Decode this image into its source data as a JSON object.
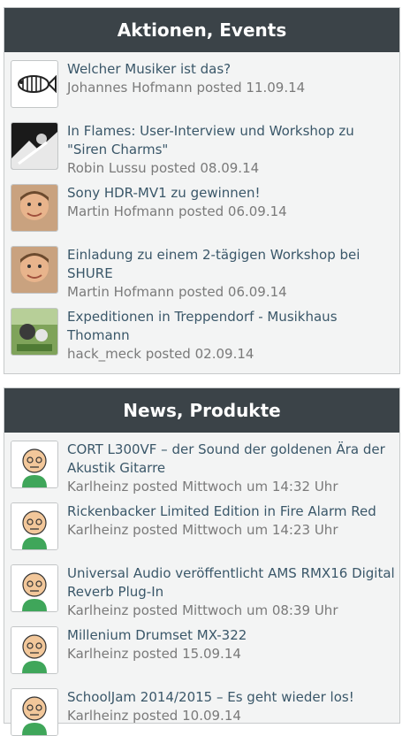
{
  "events": {
    "title": "Aktionen, Events",
    "items": [
      {
        "title": "Welcher Musiker ist das?",
        "author": "Johannes Hofmann",
        "posted": "posted",
        "date": "11.09.14"
      },
      {
        "title": "In Flames: User-Interview und Workshop zu \"Siren Charms\"",
        "author": "Robin Lussu",
        "posted": "posted",
        "date": "08.09.14"
      },
      {
        "title": "Sony HDR-MV1 zu gewinnen!",
        "author": "Martin Hofmann",
        "posted": "posted",
        "date": "06.09.14"
      },
      {
        "title": "Einladung zu einem 2-tägigen Workshop bei SHURE",
        "author": "Martin Hofmann",
        "posted": "posted",
        "date": "06.09.14"
      },
      {
        "title": "Expeditionen in Treppendorf - Musikhaus Thomann",
        "author": "hack_meck",
        "posted": "posted",
        "date": "02.09.14"
      }
    ]
  },
  "news": {
    "title": "News, Produkte",
    "items": [
      {
        "title": "CORT L300VF – der Sound der goldenen Ära der Akustik Gitarre",
        "author": "Karlheinz",
        "posted": "posted",
        "date": "Mittwoch um 14:32 Uhr"
      },
      {
        "title": "Rickenbacker Limited Edition in Fire Alarm Red",
        "author": "Karlheinz",
        "posted": "posted",
        "date": "Mittwoch um 14:23 Uhr"
      },
      {
        "title": "Universal Audio veröffentlicht AMS RMX16 Digital Reverb Plug-In",
        "author": "Karlheinz",
        "posted": "posted",
        "date": "Mittwoch um 08:39 Uhr"
      },
      {
        "title": "Millenium Drumset MX-322",
        "author": "Karlheinz",
        "posted": "posted",
        "date": "15.09.14"
      },
      {
        "title": "SchoolJam 2014/2015 – Es geht wieder los!",
        "author": "Karlheinz",
        "posted": "posted",
        "date": "10.09.14"
      }
    ]
  },
  "colors": {
    "header_bg": "#3b4348",
    "link": "#3a5769",
    "meta": "#7a7a7a",
    "panel_bg": "#f3f4f4"
  }
}
